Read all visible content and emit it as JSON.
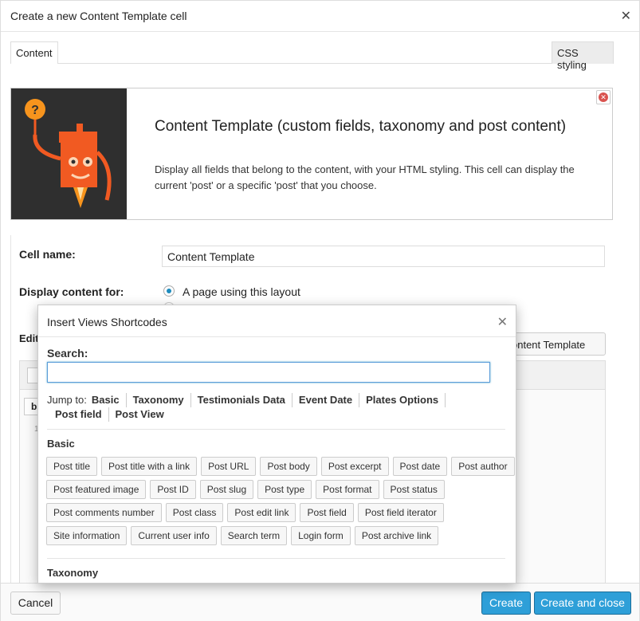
{
  "dialog": {
    "title": "Create a new Content Template cell",
    "close_glyph": "✕"
  },
  "tabs": {
    "content": "Content",
    "css_styling": "CSS styling"
  },
  "hero": {
    "title": "Content Template (custom fields, taxonomy and post content)",
    "description": "Display all fields that belong to the content, with your HTML styling. This cell can display the current 'post' or a specific 'post' that you choose.",
    "remove_glyph": "✕"
  },
  "form": {
    "cell_name_label": "Cell name:",
    "cell_name_value": "Content Template",
    "display_for_label": "Display content for:",
    "radio_option_1": "A page using this layout",
    "edit_label_partial": "Edit",
    "template_button_partial": "ontent Template",
    "editor_bold": "b",
    "line_number": "1"
  },
  "popup": {
    "title": "Insert Views Shortcodes",
    "close_glyph": "✕",
    "search_label": "Search:",
    "search_value": "",
    "jump_to_label": "Jump to:",
    "jump_links": [
      "Basic",
      "Taxonomy",
      "Testimonials Data",
      "Event Date",
      "Plates Options",
      "Post field",
      "Post View"
    ],
    "section_basic": "Basic",
    "section_taxonomy": "Taxonomy",
    "basic_rows": [
      [
        "Post title",
        "Post title with a link",
        "Post URL",
        "Post body",
        "Post excerpt",
        "Post date",
        "Post author"
      ],
      [
        "Post featured image",
        "Post ID",
        "Post slug",
        "Post type",
        "Post format",
        "Post status"
      ],
      [
        "Post comments number",
        "Post class",
        "Post edit link",
        "Post field",
        "Post field iterator"
      ],
      [
        "Site information",
        "Current user info",
        "Search term",
        "Login form",
        "Post archive link"
      ]
    ]
  },
  "footer": {
    "cancel": "Cancel",
    "create": "Create",
    "create_close": "Create and close"
  },
  "colors": {
    "primary": "#2e9fd8",
    "robot_orange": "#f15a22",
    "error_red": "#d9534f"
  }
}
